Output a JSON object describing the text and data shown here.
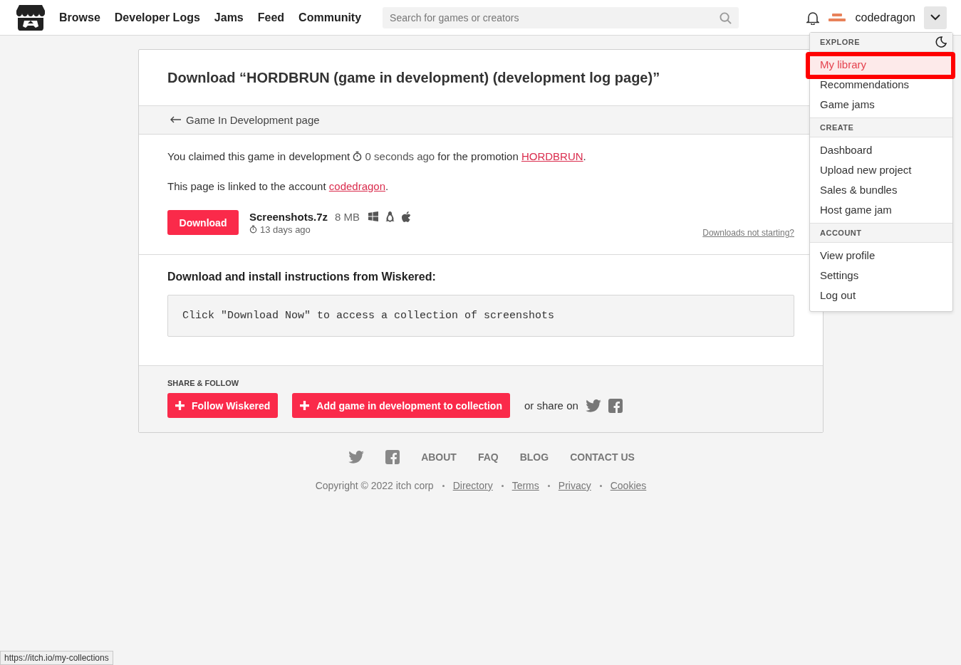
{
  "header": {
    "nav": [
      {
        "label": "Browse"
      },
      {
        "label": "Developer Logs"
      },
      {
        "label": "Jams"
      },
      {
        "label": "Feed"
      },
      {
        "label": "Community"
      }
    ],
    "search": {
      "placeholder": "Search for games or creators"
    },
    "username": "codedragon",
    "menu_open": true
  },
  "menu": {
    "sections": [
      {
        "heading": "EXPLORE",
        "items": [
          {
            "label": "My library",
            "selected": true
          },
          {
            "label": "Recommendations",
            "selected": false
          },
          {
            "label": "Game jams",
            "selected": false
          }
        ]
      },
      {
        "heading": "CREATE",
        "items": [
          {
            "label": "Dashboard",
            "selected": false
          },
          {
            "label": "Upload new project",
            "selected": false
          },
          {
            "label": "Sales & bundles",
            "selected": false
          },
          {
            "label": "Host game jam",
            "selected": false
          }
        ]
      },
      {
        "heading": "ACCOUNT",
        "items": [
          {
            "label": "View profile",
            "selected": false
          },
          {
            "label": "Settings",
            "selected": false
          },
          {
            "label": "Log out",
            "selected": false
          }
        ]
      }
    ]
  },
  "page": {
    "title": "Download “HORDBRUN (game in development) (development log page)”",
    "back_link": "Game In Development page",
    "claim": {
      "before": "You claimed this game in development",
      "time": "0 seconds ago",
      "middle": "for the promotion",
      "link": "HORDBRUN",
      "after": "."
    },
    "account": {
      "before": "This page is linked to the account",
      "link": "codedragon",
      "after": "."
    },
    "uploads": [
      {
        "button": "Download",
        "name": "Screenshots.7z",
        "size": "8 MB",
        "platforms": [
          {
            "kind": "windows"
          },
          {
            "kind": "linux"
          },
          {
            "kind": "mac"
          }
        ],
        "age": "13 days ago"
      }
    ],
    "not_starting": "Downloads not starting?",
    "instructions_heading": "Download and install instructions from Wiskered:",
    "instructions": "Click \"Download Now\" to access a collection of screenshots",
    "share": {
      "heading": "SHARE & FOLLOW",
      "follow": "Follow Wiskered",
      "collection": "Add game in development to collection",
      "share_text": "or share on"
    }
  },
  "footer": {
    "links": [
      "ABOUT",
      "FAQ",
      "BLOG",
      "CONTACT US"
    ],
    "copyright": "Copyright © 2022 itch corp",
    "legal": [
      "Directory",
      "Terms",
      "Privacy",
      "Cookies"
    ]
  },
  "status_bar": {
    "url": "https://itch.io/my-collections"
  }
}
